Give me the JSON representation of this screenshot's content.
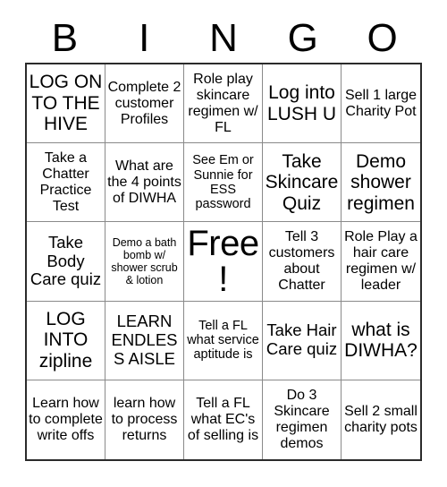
{
  "card": {
    "title": "BINGO",
    "header_letters": [
      "B",
      "I",
      "N",
      "G",
      "O"
    ],
    "rows": 5,
    "columns": 5,
    "free_space_index": 12,
    "colors": {
      "background": "#ffffff",
      "text": "#000000",
      "outer_border": "#2b2b2b",
      "grid_line": "#8a8a8a"
    }
  },
  "cells": [
    {
      "text": "LOG ON TO THE HIVE",
      "size": "s-xl",
      "column": "B"
    },
    {
      "text": "Complete 2 customer Profiles",
      "size": "s-md",
      "column": "I"
    },
    {
      "text": "Role play skincare regimen w/ FL",
      "size": "s-md",
      "column": "N"
    },
    {
      "text": "Log into LUSH U",
      "size": "s-xl",
      "column": "G"
    },
    {
      "text": "Sell 1 large Charity Pot",
      "size": "s-md",
      "column": "O"
    },
    {
      "text": "Take a Chatter Practice Test",
      "size": "s-md",
      "column": "B"
    },
    {
      "text": "What are the 4 points of DIWHA",
      "size": "s-md",
      "column": "I"
    },
    {
      "text": "See Em or Sunnie for ESS password",
      "size": "s-sm",
      "column": "N"
    },
    {
      "text": "Take Skincare Quiz",
      "size": "s-xl",
      "column": "G"
    },
    {
      "text": "Demo shower regimen",
      "size": "s-xl",
      "column": "O"
    },
    {
      "text": "Take Body Care quiz",
      "size": "s-lg",
      "column": "B"
    },
    {
      "text": "Demo a bath bomb w/ shower scrub & lotion",
      "size": "s-xs",
      "column": "I"
    },
    {
      "text": "Free!",
      "size": "s-free",
      "column": "N"
    },
    {
      "text": "Tell 3 customers about Chatter",
      "size": "s-md",
      "column": "G"
    },
    {
      "text": "Role Play a hair care regimen w/ leader",
      "size": "s-md",
      "column": "O"
    },
    {
      "text": "LOG INTO zipline",
      "size": "s-xl",
      "column": "B"
    },
    {
      "text": "LEARN ENDLESS AISLE",
      "size": "s-lg",
      "column": "I"
    },
    {
      "text": "Tell a FL what service aptitude is",
      "size": "s-sm",
      "column": "N"
    },
    {
      "text": "Take Hair Care quiz",
      "size": "s-lg",
      "column": "G"
    },
    {
      "text": "what is DIWHA?",
      "size": "s-xl",
      "column": "O"
    },
    {
      "text": "Learn how to complete write offs",
      "size": "s-md",
      "column": "B"
    },
    {
      "text": "learn how to process returns",
      "size": "s-md",
      "column": "I"
    },
    {
      "text": "Tell a FL what EC's of selling is",
      "size": "s-md",
      "column": "N"
    },
    {
      "text": "Do 3 Skincare regimen demos",
      "size": "s-md",
      "column": "G"
    },
    {
      "text": "Sell 2 small charity pots",
      "size": "s-md",
      "column": "O"
    }
  ]
}
